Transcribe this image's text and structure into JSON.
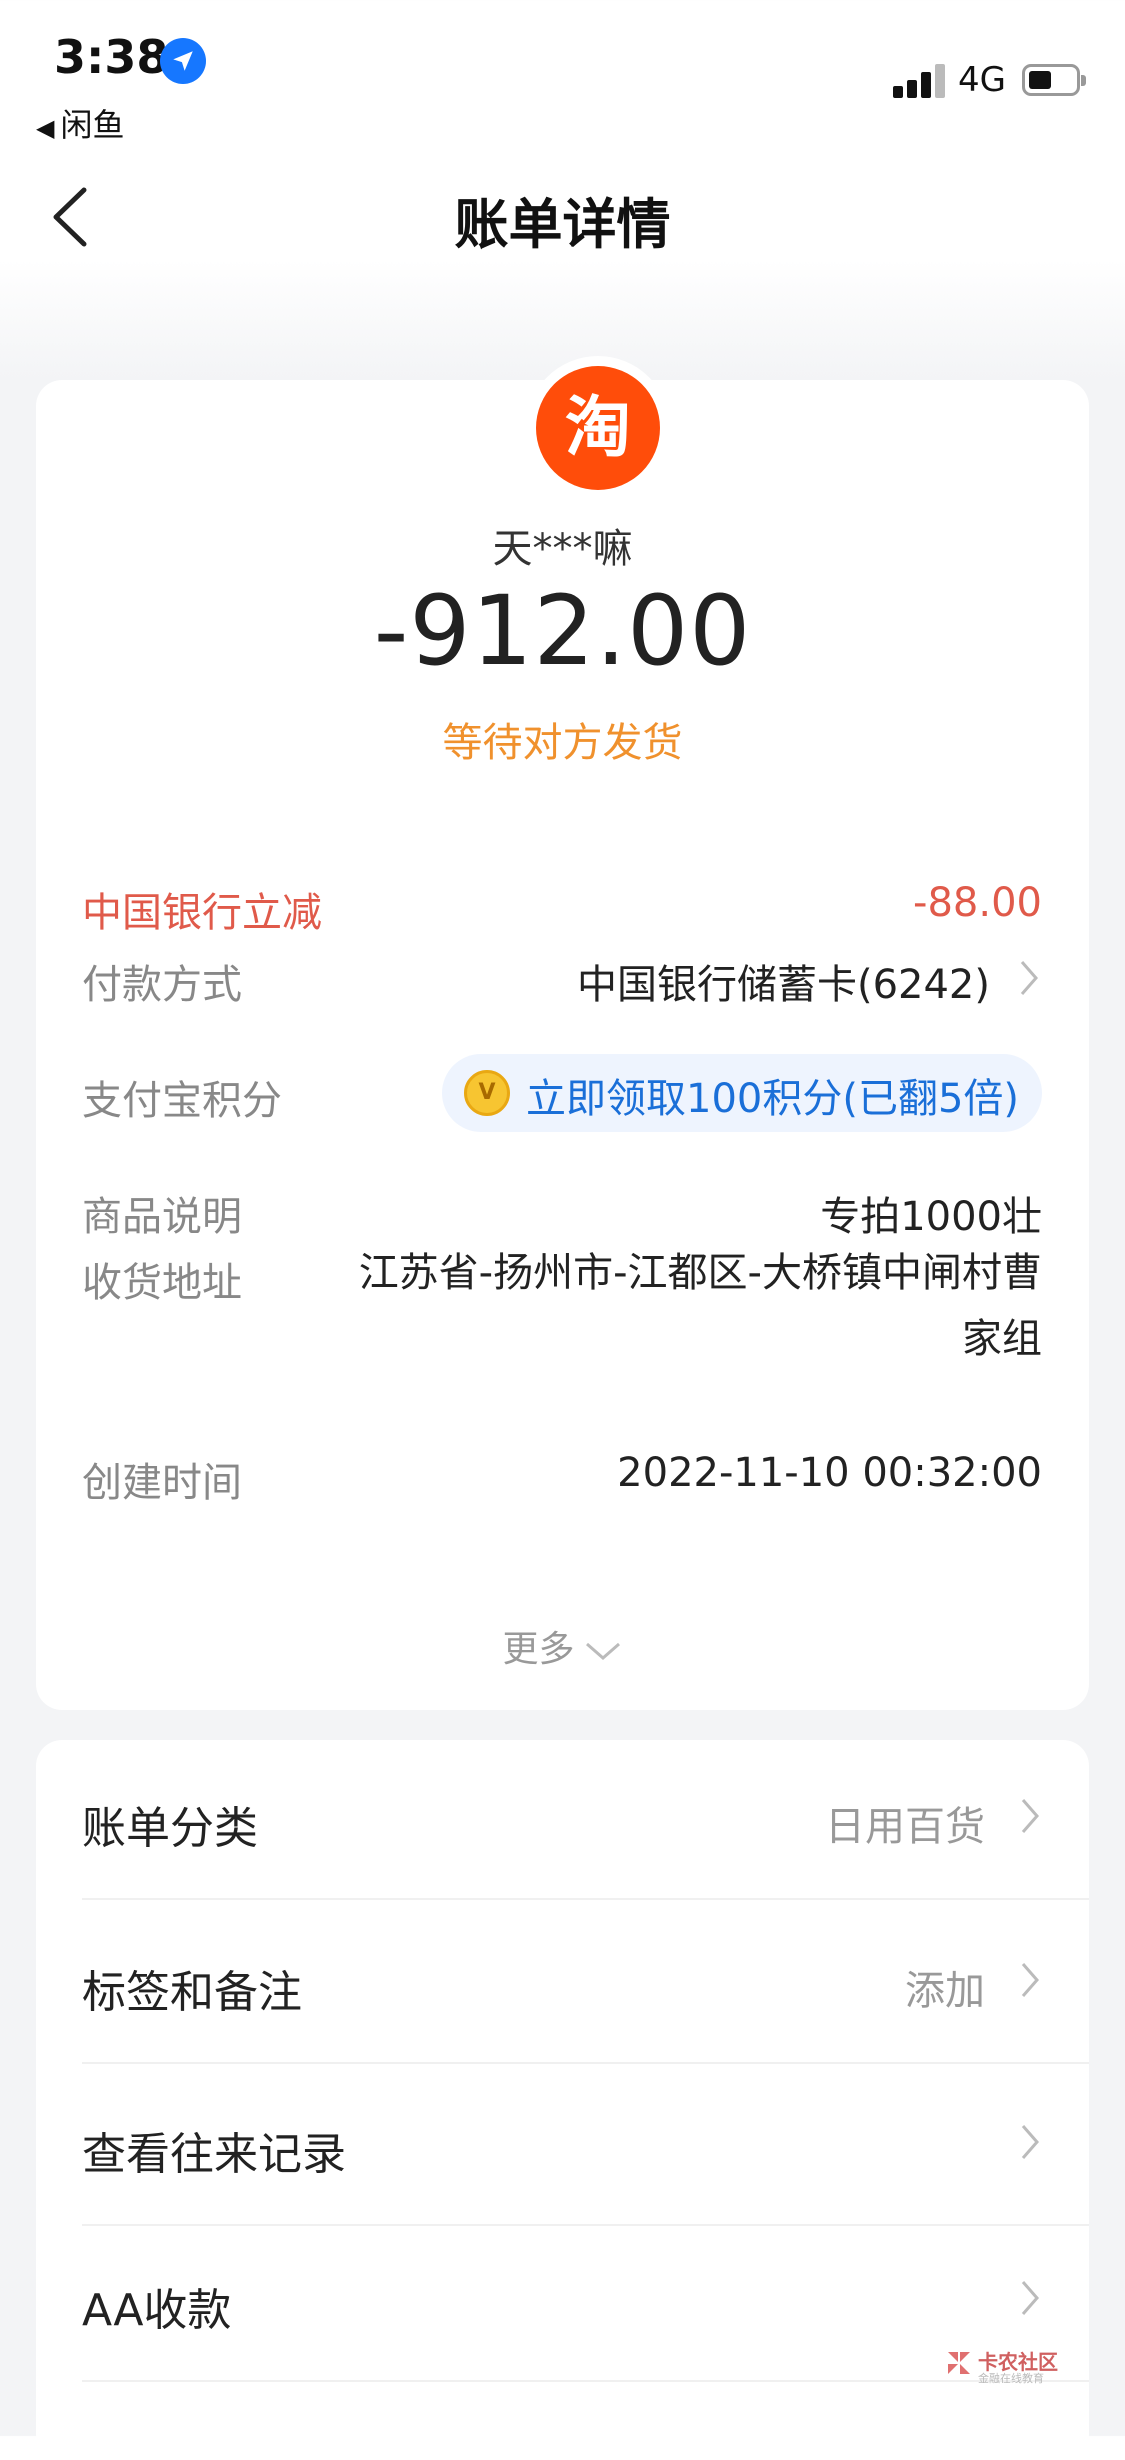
{
  "status_bar": {
    "time": "3:38",
    "back_app": "闲鱼",
    "network": "4G"
  },
  "nav": {
    "title": "账单详情"
  },
  "bill": {
    "logo_char": "淘",
    "merchant": "天***嘛",
    "amount": "-912.00",
    "status": "等待对方发货"
  },
  "details": {
    "discount": {
      "label": "中国银行立减",
      "value": "-88.00"
    },
    "payment": {
      "label": "付款方式",
      "value": "中国银行储蓄卡(6242)"
    },
    "points": {
      "label": "支付宝积分",
      "value": "立即领取100积分(已翻5倍)",
      "coin_char": "V"
    },
    "goods": {
      "label": "商品说明",
      "value": "专拍1000壮"
    },
    "address": {
      "label": "收货地址",
      "value": "江苏省-扬州市-江都区-大桥镇中闸村曹家组"
    },
    "created": {
      "label": "创建时间",
      "value": "2022-11-10 00:32:00"
    },
    "more": "更多"
  },
  "actions": [
    {
      "label": "账单分类",
      "value": "日用百货"
    },
    {
      "label": "标签和备注",
      "value": "添加"
    },
    {
      "label": "查看往来记录",
      "value": ""
    },
    {
      "label": "AA收款",
      "value": ""
    }
  ],
  "watermark": {
    "title": "卡农社区",
    "subtitle": "金融在线教育"
  },
  "colors": {
    "accent_orange": "#f0912d",
    "discount_red": "#e05a4a",
    "link_blue": "#1a6fd8",
    "taobao_orange": "#ff4d0a"
  }
}
